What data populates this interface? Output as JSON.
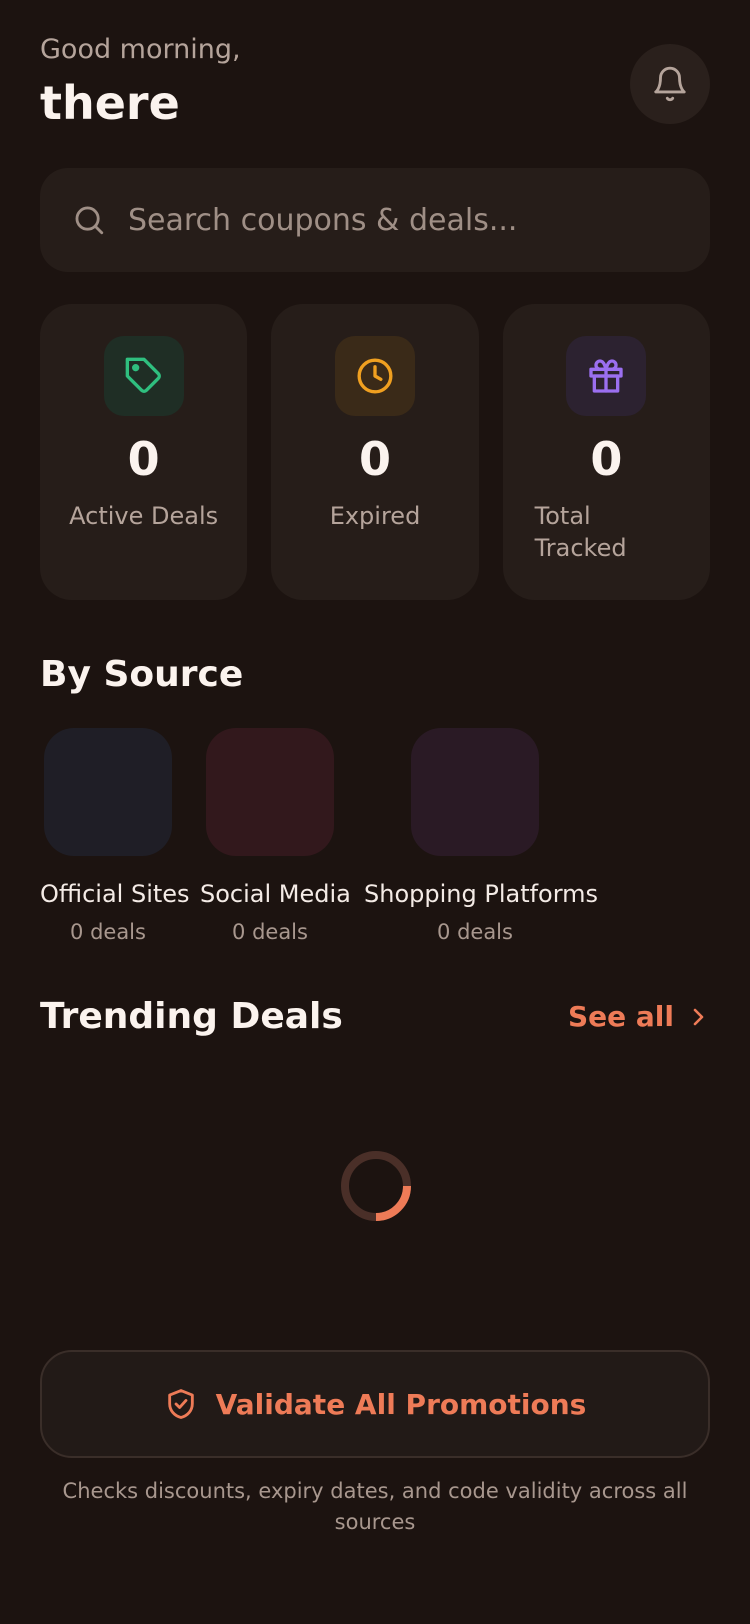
{
  "header": {
    "greeting": "Good morning,",
    "name": "there",
    "bell_icon": "bell-icon"
  },
  "search": {
    "placeholder": "Search coupons & deals...",
    "value": "",
    "icon": "search-icon"
  },
  "stats": [
    {
      "icon": "tag-icon",
      "value": "0",
      "label": "Active Deals",
      "color": "#2fbf7f",
      "icon_bg": "#1f2e25"
    },
    {
      "icon": "clock-icon",
      "value": "0",
      "label": "Expired",
      "color": "#f0a020",
      "icon_bg": "#3a2a18"
    },
    {
      "icon": "gift-icon",
      "value": "0",
      "label": "Total Tracked",
      "color": "#9b6ff0",
      "icon_bg": "#2c2230"
    }
  ],
  "sources": {
    "title": "By Source",
    "items": [
      {
        "name": "Official Sites",
        "count": "0 deals",
        "color": "#1f1e26"
      },
      {
        "name": "Social Media",
        "count": "0 deals",
        "color": "#32181c"
      },
      {
        "name": "Shopping Platforms",
        "count": "0 deals",
        "color": "#2a1a25"
      }
    ]
  },
  "trending": {
    "title": "Trending Deals",
    "see_all": "See all"
  },
  "validate": {
    "label": "Validate All Promotions",
    "footnote": "Checks discounts, expiry dates, and code validity across all sources"
  },
  "colors": {
    "background": "#1c1310",
    "card": "#261d19",
    "accent": "#ee7b57"
  }
}
